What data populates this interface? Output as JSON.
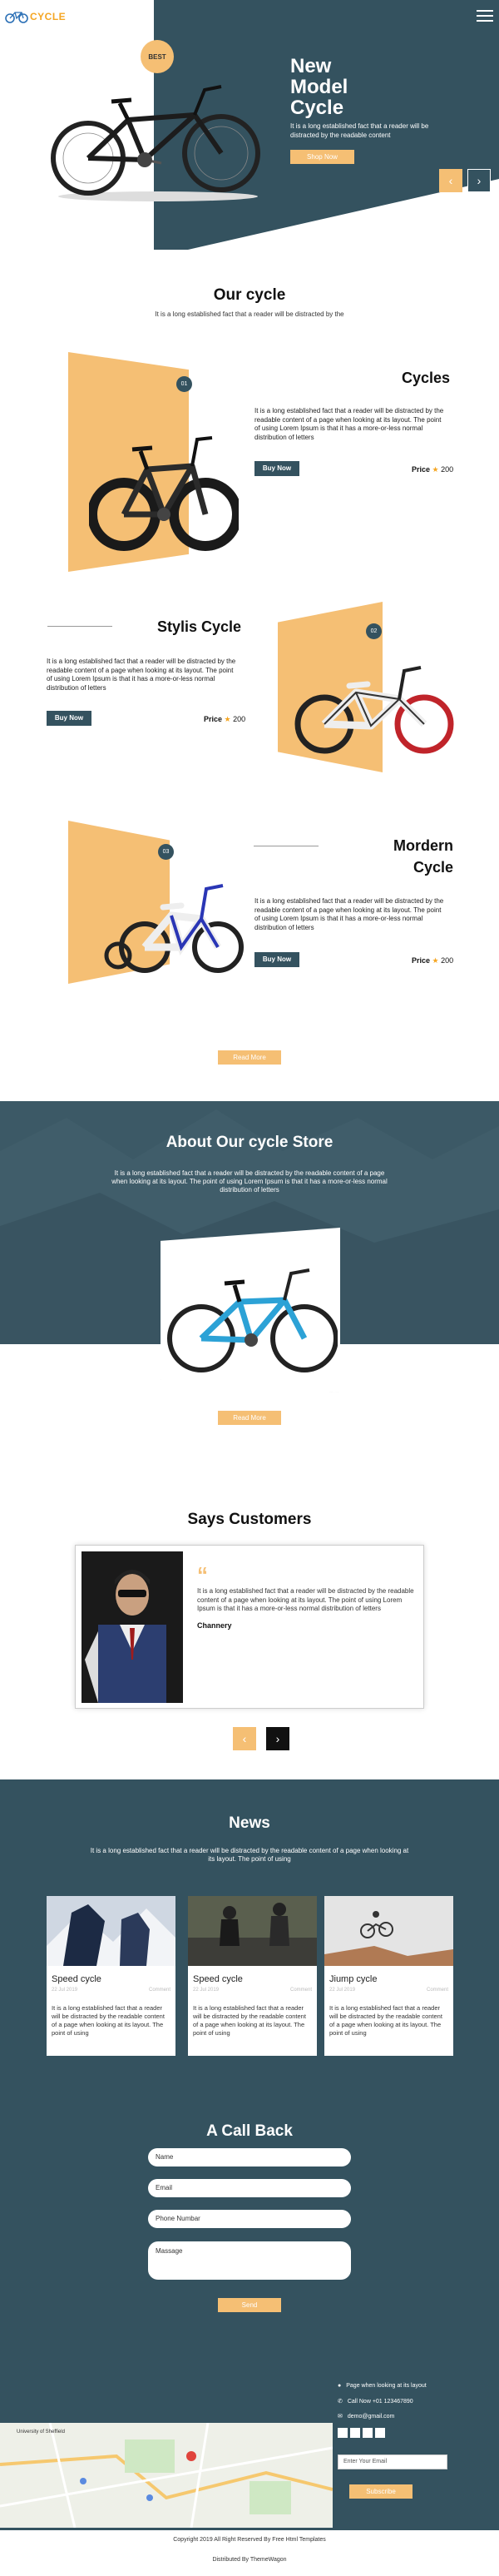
{
  "brand": {
    "logo_text": "CYCLE"
  },
  "hero": {
    "badge": "BEST",
    "title_line1": "New",
    "title_line2": "Model",
    "title_line3": "Cycle",
    "text": "It is a long established fact that a reader will be distracted by the readable content",
    "button": "Shop Now",
    "prev": "‹",
    "next": "›"
  },
  "our_cycle": {
    "title": "Our cycle",
    "subtitle": "It is a long established fact that a reader will be distracted by the",
    "products": [
      {
        "num": "01",
        "title": "Cycles",
        "text": "It is a long established fact that a reader will be distracted by the readable content of a page when looking at its layout. The point of using Lorem Ipsum is that it has a more-or-less normal distribution of letters",
        "buy": "Buy Now",
        "price_label": "Price",
        "price": "200"
      },
      {
        "num": "02",
        "title": "Stylis Cycle",
        "text": "It is a long established fact that a reader will be distracted by the readable content of a page when looking at its layout. The point of using Lorem Ipsum is that it has a more-or-less normal distribution of letters",
        "buy": "Buy Now",
        "price_label": "Price",
        "price": "200"
      },
      {
        "num": "03",
        "title_line1": "Mordern",
        "title_line2": "Cycle",
        "text": "It is a long established fact that a reader will be distracted by the readable content of a page when looking at its layout. The point of using Lorem Ipsum is that it has a more-or-less normal distribution of letters",
        "buy": "Buy Now",
        "price_label": "Price",
        "price": "200"
      }
    ],
    "read_more": "Read More"
  },
  "about": {
    "title": "About Our cycle Store",
    "text": "It is a long established fact that a reader will be distracted by the readable content of a page when looking at its layout. The point of using Lorem Ipsum is that it has a more-or-less normal distribution of letters",
    "read_more": "Read More"
  },
  "customers": {
    "title": "Says Customers",
    "quote_mark": "“",
    "text": "It is a long established fact that a reader will be distracted by the readable content of a page when looking at its layout. The point of using Lorem Ipsum is that it has a more-or-less normal distribution of letters",
    "name": "Channery",
    "prev": "‹",
    "next": "›"
  },
  "news": {
    "title": "News",
    "subtitle": "It is a long established fact that a reader will be distracted by the readable content of a page when looking at its layout. The point of using",
    "items": [
      {
        "title": "Speed cycle",
        "date": "22 Jul 2019",
        "comments": "Comment",
        "text": "It is a long established fact that a reader will be distracted by the readable content of a page when looking at its layout. The point of using"
      },
      {
        "title": "Speed cycle",
        "date": "22 Jul 2019",
        "comments": "Comment",
        "text": "It is a long established fact that a reader will be distracted by the readable content of a page when looking at its layout. The point of using"
      },
      {
        "title": "Jiump cycle",
        "date": "22 Jul 2019",
        "comments": "Comment",
        "text": "It is a long established fact that a reader will be distracted by the readable content of a page when looking at its layout. The point of using"
      }
    ]
  },
  "callback": {
    "title": "A Call Back",
    "name_placeholder": "Name",
    "email_placeholder": "Email",
    "phone_placeholder": "Phone Numbar",
    "message_placeholder": "Massage",
    "send": "Send"
  },
  "footer": {
    "address": "Page when looking at its layout",
    "phone": "Call Now +01 123467890",
    "email": "demo@gmail.com",
    "subscribe_placeholder": "Enter Your Email",
    "subscribe": "Subscribe",
    "map_label": "University of Sheffield",
    "copyright": "Copyright 2019 All Right Reserved By Free Html Templates",
    "distributed": "Distributed By ThemeWagon"
  },
  "colors": {
    "teal": "#34525f",
    "orange": "#f5bf74",
    "accent": "#f5a623"
  }
}
